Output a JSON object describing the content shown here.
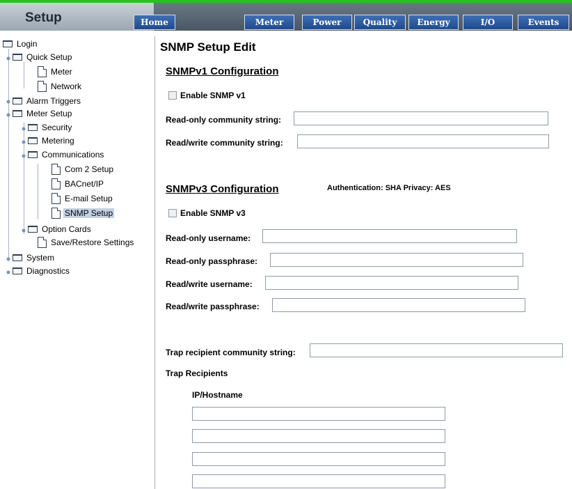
{
  "header": {
    "section_title": "Setup",
    "nav": [
      "Home",
      "Meter",
      "Power",
      "Quality",
      "Energy",
      "I/O",
      "Events"
    ]
  },
  "sidebar": {
    "items": [
      {
        "label": "Login",
        "icon": "folder-icon"
      },
      {
        "label": "Quick Setup",
        "icon": "folder-icon"
      },
      {
        "label": "Meter",
        "icon": "page-icon"
      },
      {
        "label": "Network",
        "icon": "page-icon"
      },
      {
        "label": "Alarm Triggers",
        "icon": "folder-icon"
      },
      {
        "label": "Meter Setup",
        "icon": "folder-icon"
      },
      {
        "label": "Security",
        "icon": "folder-icon"
      },
      {
        "label": "Metering",
        "icon": "folder-icon"
      },
      {
        "label": "Communications",
        "icon": "folder-icon"
      },
      {
        "label": "Com 2 Setup",
        "icon": "page-icon"
      },
      {
        "label": "BACnet/IP",
        "icon": "page-icon"
      },
      {
        "label": "E-mail Setup",
        "icon": "page-icon"
      },
      {
        "label": "SNMP Setup",
        "icon": "page-icon",
        "selected": true
      },
      {
        "label": "Option Cards",
        "icon": "folder-icon"
      },
      {
        "label": "Save/Restore Settings",
        "icon": "page-icon"
      },
      {
        "label": "System",
        "icon": "folder-icon"
      },
      {
        "label": "Diagnostics",
        "icon": "folder-icon"
      }
    ]
  },
  "main": {
    "page_title": "SNMP Setup Edit",
    "v1": {
      "title": "SNMPv1 Configuration",
      "enable_label": "Enable SNMP v1",
      "ro_community_label": "Read-only community string:",
      "ro_community_value": "",
      "rw_community_label": "Read/write community string:",
      "rw_community_value": ""
    },
    "v3": {
      "title": "SNMPv3 Configuration",
      "auth_info": "Authentication: SHA Privacy: AES",
      "enable_label": "Enable SNMP v3",
      "ro_user_label": "Read-only username:",
      "ro_pass_label": "Read-only passphrase:",
      "rw_user_label": "Read/write username:",
      "rw_pass_label": "Read/write passphrase:"
    },
    "trap": {
      "community_label": "Trap recipient community string:",
      "recipients_label": "Trap Recipients",
      "column_header": "IP/Hostname",
      "recipients": [
        "",
        "",
        "",
        ""
      ]
    }
  },
  "colors": {
    "accent_green": "#27c21e",
    "nav_blue": "#2c5ca0",
    "header_gray": "#5a6674",
    "selected_bg": "#c3d1e2"
  }
}
